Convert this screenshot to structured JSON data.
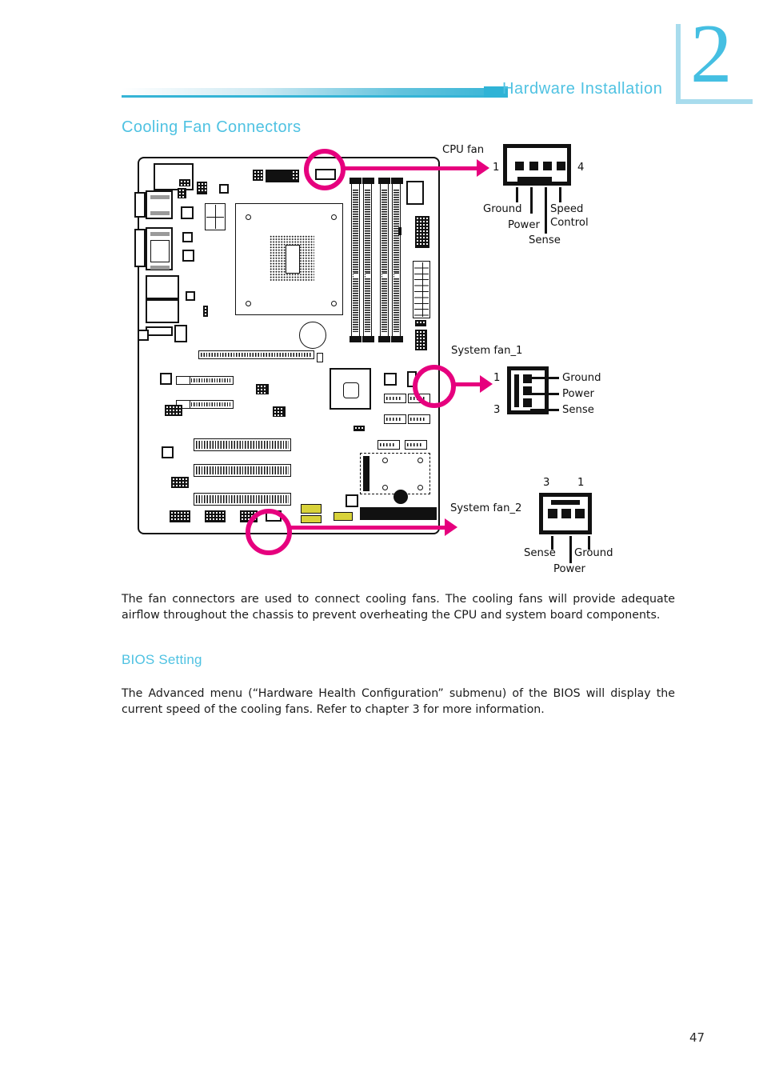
{
  "header": {
    "chapter_number": "2",
    "title": "Hardware Installation"
  },
  "page_title": "Cooling Fan Connectors",
  "page_number": "47",
  "diagrams": {
    "cpu_fan": {
      "name": "CPU fan",
      "pin_first": "1",
      "pin_last": "4",
      "pin_count": 4,
      "signals": [
        "Ground",
        "Power",
        "Sense",
        "Speed Control"
      ],
      "speed_control_line1": "Speed",
      "speed_control_line2": "Control"
    },
    "system_fan_1": {
      "name": "System fan_1",
      "pin_first": "1",
      "pin_last": "3",
      "pin_count": 3,
      "signals": [
        "Ground",
        "Power",
        "Sense"
      ]
    },
    "system_fan_2": {
      "name": "System fan_2",
      "pin_left": "3",
      "pin_right": "1",
      "pin_count": 3,
      "signals": [
        "Sense",
        "Power",
        "Ground"
      ]
    }
  },
  "body": {
    "paragraph_1": "The fan connectors are used to connect cooling fans. The cooling fans will provide adequate airflow throughout the chassis to prevent overheating the CPU and system board components.",
    "bios_heading": "BIOS Setting",
    "paragraph_2": "The Advanced menu (“Hardware Health Configuration” submenu) of the BIOS will display the current speed of the cooling fans. Refer to chapter 3 for more information."
  },
  "colors": {
    "accent_teal": "#4fc2e2",
    "accent_teal_dark": "#35b4d6",
    "accent_teal_light": "#a8dced",
    "highlight_magenta": "#e6007e",
    "ink": "#111111",
    "header_pale": "#cfeaf3"
  }
}
